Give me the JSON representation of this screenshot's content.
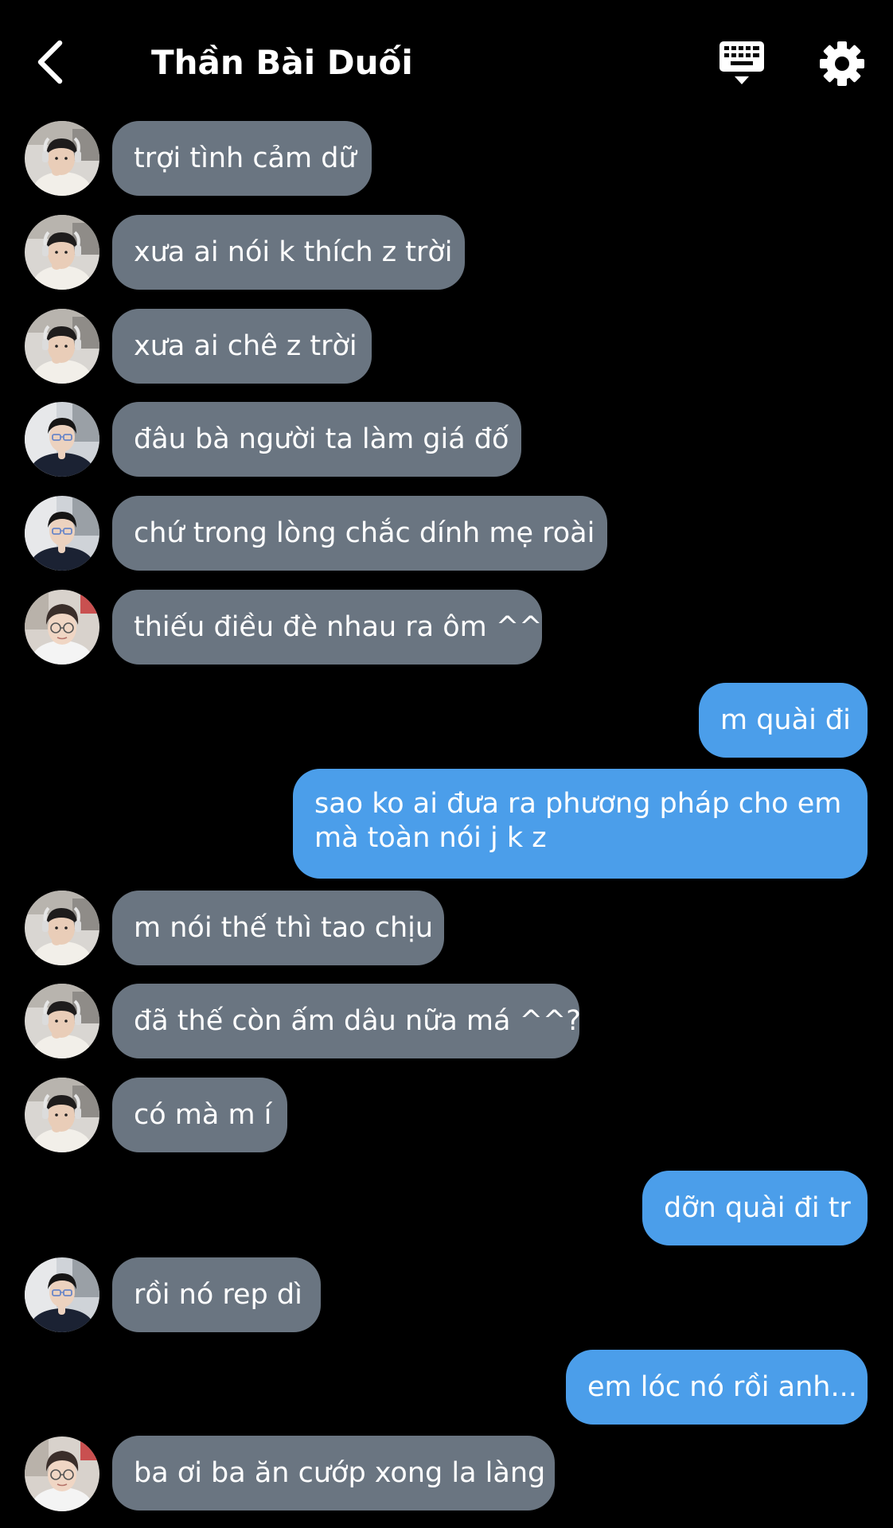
{
  "header": {
    "title": "Thần Bài Duối",
    "back_icon": "chevron-left-icon",
    "keyboard_icon": "keyboard-icon",
    "settings_icon": "gear-icon"
  },
  "colors": {
    "background": "#000000",
    "incoming_bubble": "#6a7581",
    "outgoing_bubble": "#4b9eea",
    "text": "#ffffff"
  },
  "messages": [
    {
      "direction": "in",
      "avatar": "avatar-a",
      "text": "trợi tình cảm dữ"
    },
    {
      "direction": "in",
      "avatar": "avatar-a",
      "text": "xưa ai nói k thích z trời"
    },
    {
      "direction": "in",
      "avatar": "avatar-a",
      "text": "xưa ai chê z trời"
    },
    {
      "direction": "in",
      "avatar": "avatar-b",
      "text": "đâu bà người ta làm giá đố"
    },
    {
      "direction": "in",
      "avatar": "avatar-b",
      "text": "chứ trong lòng chắc dính mẹ roài"
    },
    {
      "direction": "in",
      "avatar": "avatar-c",
      "text": "thiếu điều đè nhau ra ôm ^^"
    },
    {
      "direction": "out",
      "text": "m quài đi"
    },
    {
      "direction": "out",
      "lines": [
        "sao ko ai đưa ra phương pháp cho em",
        "mà toàn nói j k z"
      ]
    },
    {
      "direction": "in",
      "avatar": "avatar-a",
      "text": "m nói thế thì tao chịu"
    },
    {
      "direction": "in",
      "avatar": "avatar-a",
      "text": "đã thế còn ấm dâu nữa má ^^?"
    },
    {
      "direction": "in",
      "avatar": "avatar-a",
      "text": "có mà m í"
    },
    {
      "direction": "out",
      "text": "dỡn quài đi tr"
    },
    {
      "direction": "in",
      "avatar": "avatar-b",
      "text": "rồi nó rep dì"
    },
    {
      "direction": "out",
      "text": "em lóc nó rồi anh..."
    },
    {
      "direction": "in",
      "avatar": "avatar-c",
      "text": "ba ơi ba ăn cướp xong la làng"
    }
  ]
}
